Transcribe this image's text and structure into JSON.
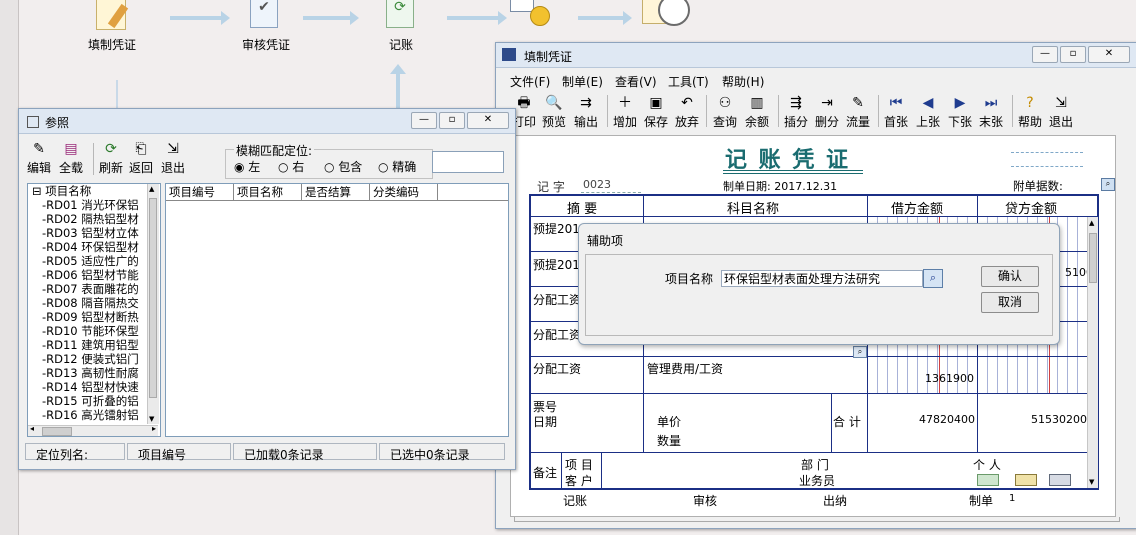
{
  "flow": {
    "steps": [
      "填制凭证",
      "审核凭证",
      "记账"
    ]
  },
  "ref_window": {
    "title": "参照",
    "toolbar": [
      "编辑",
      "全载",
      "刷新",
      "返回",
      "退出"
    ],
    "match_label": "模糊匹配定位:",
    "match_options": [
      "左",
      "右",
      "包含",
      "精确"
    ],
    "tree_root": "项目名称",
    "tree_items": [
      "RD01 消光环保铝",
      "RD02 隔热铝型材",
      "RD03 铝型材立体",
      "RD04 环保铝型材",
      "RD05 适应性广的",
      "RD06 铝型材节能",
      "RD07 表面雕花的",
      "RD08 隔音隔热交",
      "RD09 铝型材断热",
      "RD10 节能环保型",
      "RD11 建筑用铝型",
      "RD12 便装式铝门",
      "RD13 高韧性耐腐",
      "RD14 铝型材快速",
      "RD15 可折叠的铝",
      "RD16 高光镭射铝"
    ],
    "grid_headers": [
      "项目编号",
      "项目名称",
      "是否结算",
      "分类编码"
    ],
    "status": [
      "定位列名:",
      "项目编号",
      "已加载0条记录",
      "已选中0条记录"
    ]
  },
  "voucher_window": {
    "title": "填制凭证",
    "menu": [
      "文件(F)",
      "制单(E)",
      "查看(V)",
      "工具(T)",
      "帮助(H)"
    ],
    "toolbar": [
      "打印",
      "预览",
      "输出",
      "增加",
      "保存",
      "放弃",
      "查询",
      "余额",
      "插分",
      "删分",
      "流量",
      "首张",
      "上张",
      "下张",
      "末张",
      "帮助",
      "退出"
    ],
    "heading": "记 账 凭 证",
    "voucher_word_label": "记 字",
    "voucher_no": "0023",
    "date_label": "制单日期: 2017.12.31",
    "attach_label": "附单据数:",
    "col_headers": [
      "摘 要",
      "科目名称",
      "借方金额",
      "贷方金额"
    ],
    "rows": [
      {
        "summary": "预提2017",
        "account": "",
        "debit": "",
        "credit": ""
      },
      {
        "summary": "预提2017",
        "account": "",
        "debit": "",
        "credit": "5100"
      },
      {
        "summary": "分配工资",
        "account": "",
        "debit": "",
        "credit": ""
      },
      {
        "summary": "分配工资",
        "account": "",
        "debit": "",
        "credit": ""
      },
      {
        "summary": "分配工资",
        "account": "管理费用/工资",
        "debit": "1361900",
        "credit": ""
      }
    ],
    "ticket_label": "票号",
    "date_row_label": "日期",
    "unit_price_label": "单价",
    "quantity_label": "数量",
    "total_label": "合 计",
    "total_debit": "47820400",
    "total_credit": "51530200",
    "remark_label": "备注",
    "project_label": "项 目",
    "dept_label": "部 门",
    "person_label": "个 人",
    "customer_label": "客 户",
    "salesman_label": "业务员",
    "footer": [
      "记账",
      "审核",
      "出纳",
      "制单"
    ],
    "maker_value": "1"
  },
  "aux_dialog": {
    "title": "辅助项",
    "field_label": "项目名称",
    "field_value": "环保铝型材表面处理方法研究",
    "ok": "确认",
    "cancel": "取消"
  },
  "colors": {
    "voucher_line": "#1b2f85",
    "heading": "#1a6c70",
    "money_red": "#d04040"
  }
}
